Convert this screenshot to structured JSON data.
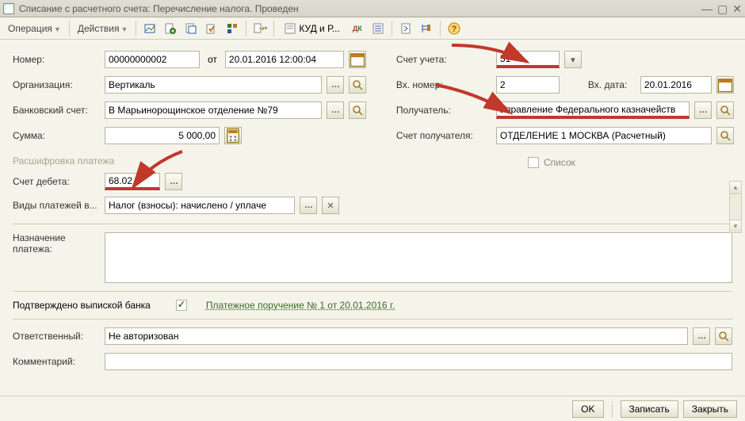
{
  "window": {
    "title": "Списание с расчетного счета: Перечисление налога. Проведен"
  },
  "toolbar": {
    "operation": "Операция",
    "actions": "Действия",
    "kud": "КУД и Р..."
  },
  "left": {
    "number_label": "Номер:",
    "number": "00000000002",
    "from": "от",
    "date": "20.01.2016 12:00:04",
    "org_label": "Организация:",
    "org": "Вертикаль",
    "bank_label": "Банковский счет:",
    "bank": "В Марьинорощинское отделение №79",
    "sum_label": "Сумма:",
    "sum": "5 000,00"
  },
  "right": {
    "account_label": "Счет учета:",
    "account": "51",
    "in_num_label": "Вх. номер:",
    "in_num": "2",
    "in_date_label": "Вх. дата:",
    "in_date": "20.01.2016",
    "recipient_label": "Получатель:",
    "recipient": "Управление Федерального казначейств",
    "rec_account_label": "Счет получателя:",
    "rec_account": "ОТДЕЛЕНИЕ 1 МОСКВА (Расчетный)"
  },
  "section": {
    "title": "Расшифровка платежа",
    "list_label": "Список",
    "debit_label": "Счет дебета:",
    "debit": "68.02",
    "pay_types_label": "Виды платежей в...",
    "pay_types": "Налог (взносы): начислено / уплаче"
  },
  "purpose": {
    "label": "Назначение платежа:"
  },
  "confirm": {
    "label": "Подтверждено выпиской банка",
    "link": "Платежное поручение № 1 от 20.01.2016 г."
  },
  "resp": {
    "label": "Ответственный:",
    "value": "Не авторизован"
  },
  "comment": {
    "label": "Комментарий:"
  },
  "footer": {
    "ok": "OK",
    "write": "Записать",
    "close": "Закрыть"
  }
}
